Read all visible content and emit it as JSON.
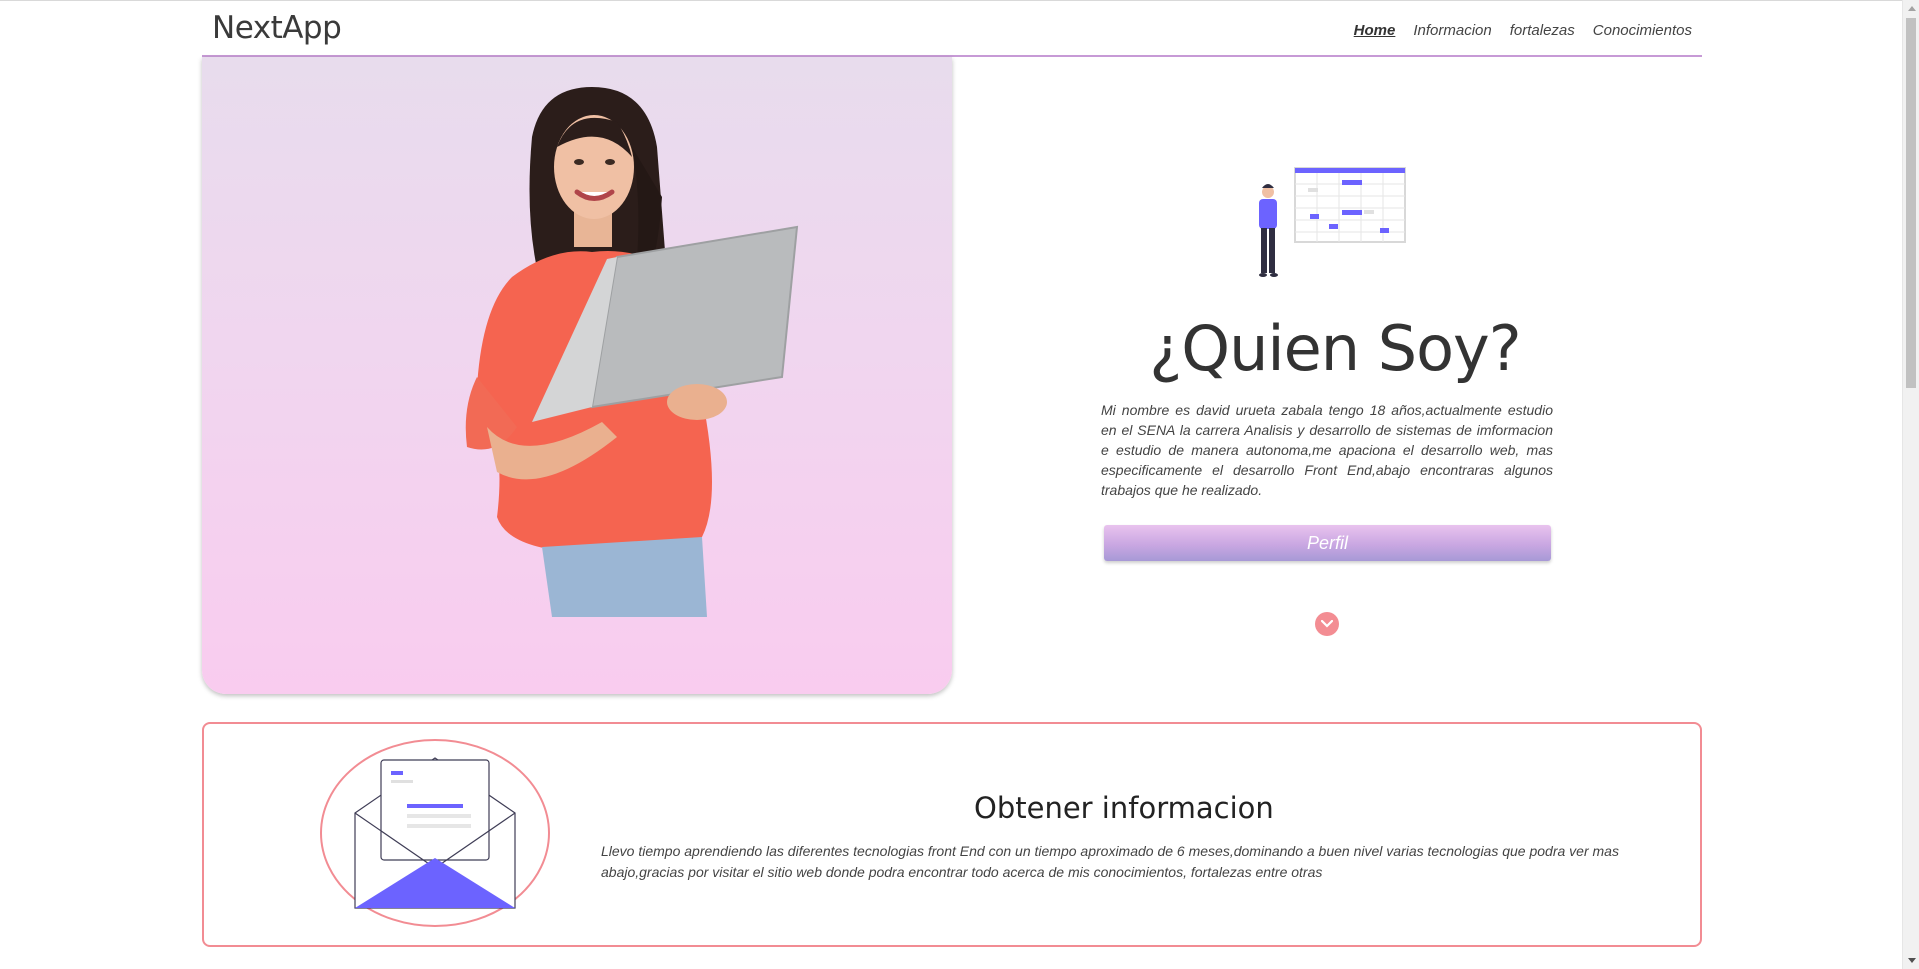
{
  "header": {
    "brand": "NextApp",
    "nav": [
      {
        "label": "Home",
        "active": true
      },
      {
        "label": "Informacion",
        "active": false
      },
      {
        "label": "fortalezas",
        "active": false
      },
      {
        "label": "Conocimientos",
        "active": false
      }
    ]
  },
  "hero": {
    "photo_icon": "woman-with-laptop-photo",
    "illustration_icon": "person-schedule-illustration",
    "title": "¿Quien Soy?",
    "bio": "Mi nombre es david urueta zabala tengo 18 años,actualmente estudio en el SENA la carrera Analisis y desarrollo de sistemas de imformacion e estudio de manera autonoma,me apaciona el desarrollo web, mas especificamente el desarrollo Front End,abajo encontraras algunos trabajos que he realizado.",
    "button_label": "Perfil",
    "scroll_icon": "chevron-down-icon"
  },
  "info": {
    "illustration_icon": "envelope-illustration",
    "title": "Obtener informacion",
    "text": "Llevo tiempo aprendiendo las diferentes tecnologias front End con un tiempo aproximado de 6 meses,dominando a buen nivel varias tecnologias que podra ver mas abajo,gracias por visitar el sitio web donde podra encontrar todo acerca de mis conocimientos, fortalezas entre otras"
  },
  "colors": {
    "accent_pink": "#f28c93",
    "accent_purple": "#6c63ff",
    "header_line": "#c79ad6"
  }
}
